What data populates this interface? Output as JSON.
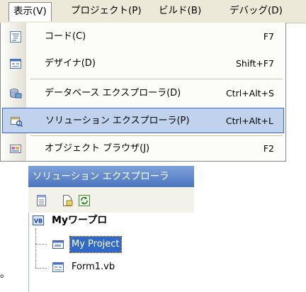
{
  "menubar": {
    "items": [
      {
        "label": "表示(V)"
      },
      {
        "label": "プロジェクト(P)"
      },
      {
        "label": "ビルド(B)"
      },
      {
        "label": "デバッグ(D)"
      }
    ]
  },
  "view_menu": {
    "items": [
      {
        "label": "コード(C)",
        "shortcut": "F7",
        "icon": "code-icon"
      },
      {
        "label": "デザイナ(D)",
        "shortcut": "Shift+F7",
        "icon": "designer-icon"
      },
      {
        "label": "データベース エクスプローラ(D)",
        "shortcut": "Ctrl+Alt+S",
        "icon": "database-explorer-icon"
      },
      {
        "label": "ソリューション エクスプローラ(P)",
        "shortcut": "Ctrl+Alt+L",
        "icon": "solution-explorer-icon",
        "selected": true
      },
      {
        "label": "オブジェクト ブラウザ(J)",
        "shortcut": "F2",
        "icon": "object-browser-icon"
      }
    ]
  },
  "solution_explorer": {
    "title": "ソリューション エクスプローラ",
    "toolbar": [
      {
        "icon": "properties-icon"
      },
      {
        "icon": "show-all-files-icon"
      },
      {
        "icon": "refresh-icon"
      }
    ],
    "tree": {
      "project": {
        "label": "Myワープロ",
        "icon": "vb-project-icon"
      },
      "children": [
        {
          "label": "My Project",
          "icon": "my-project-icon",
          "selected": true
        },
        {
          "label": "Form1.vb",
          "icon": "form-file-icon"
        }
      ]
    }
  },
  "bullet": "。",
  "colors": {
    "menubar_bg": "#ece9d8",
    "selection_bg": "#c1d2ee",
    "selection_border": "#316ac5",
    "title_bar": "#4a74be",
    "tree_selection": "#316ac5"
  }
}
